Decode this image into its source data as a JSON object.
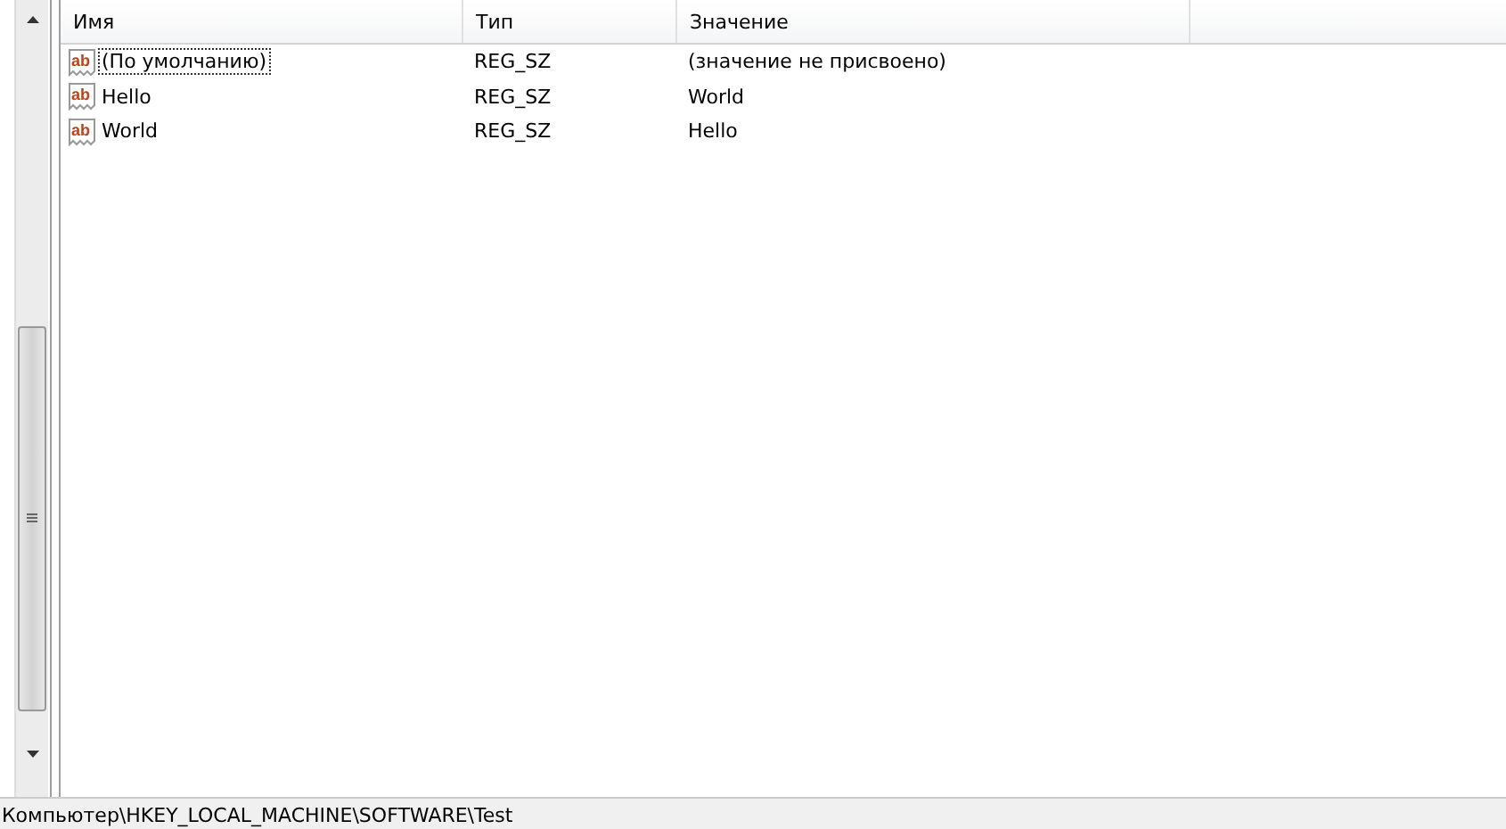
{
  "columns": [
    "Имя",
    "Тип",
    "Значение"
  ],
  "rows": [
    {
      "icon_text": "ab",
      "name": "(По умолчанию)",
      "type": "REG_SZ",
      "value": "(значение не присвоено)",
      "selected": true
    },
    {
      "icon_text": "ab",
      "name": "Hello",
      "type": "REG_SZ",
      "value": "World",
      "selected": false
    },
    {
      "icon_text": "ab",
      "name": "World",
      "type": "REG_SZ",
      "value": "Hello",
      "selected": false
    }
  ],
  "status_bar": "Компьютер\\HKEY_LOCAL_MACHINE\\SOFTWARE\\Test"
}
